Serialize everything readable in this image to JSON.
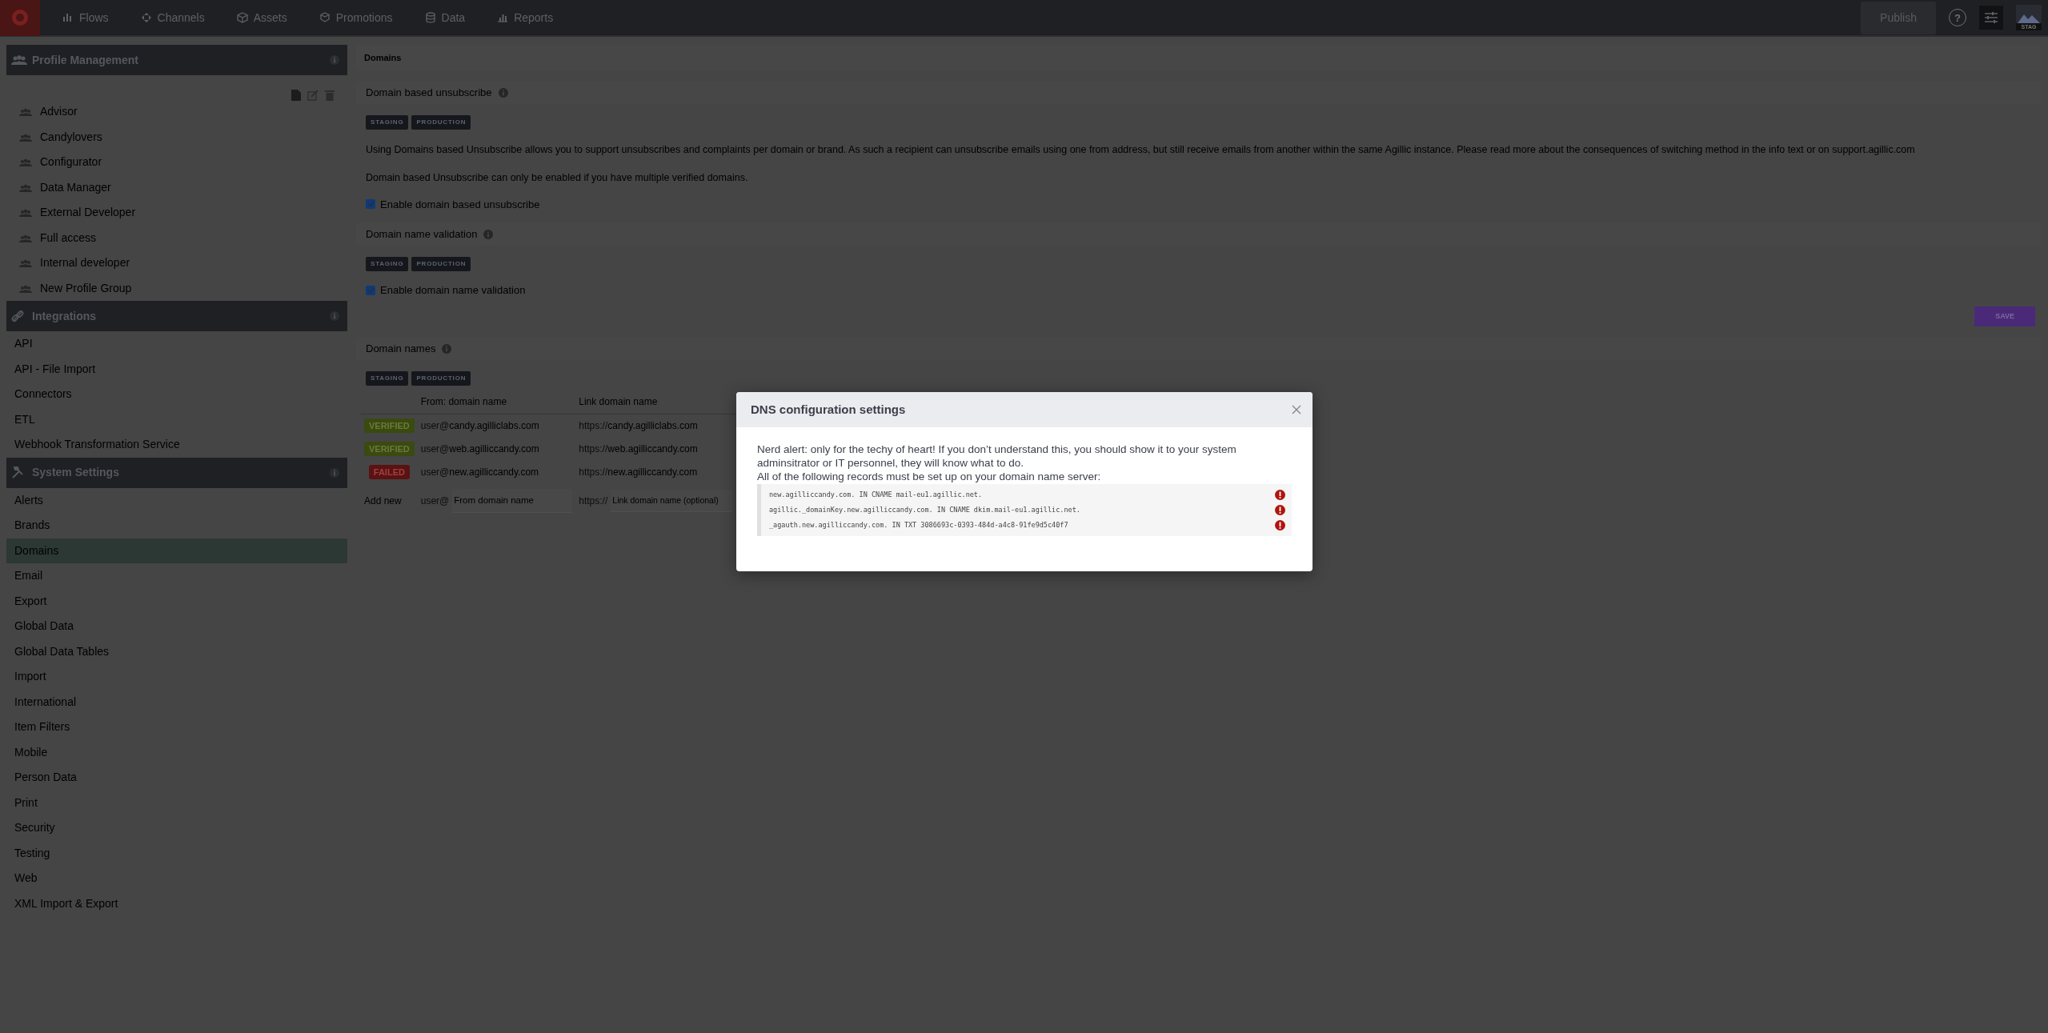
{
  "top_nav": {
    "items": [
      {
        "label": "Flows",
        "selected": false
      },
      {
        "label": "Channels",
        "selected": false
      },
      {
        "label": "Assets",
        "selected": false
      },
      {
        "label": "Promotions",
        "selected": false
      },
      {
        "label": "Data",
        "selected": false
      },
      {
        "label": "Reports",
        "selected": false
      }
    ],
    "publish": "Publish",
    "help": "?",
    "env_badge": "STAG"
  },
  "sidebar": {
    "sections": [
      {
        "title": "Profile Management",
        "kind": "profiles",
        "items": [
          {
            "label": "Advisor",
            "selected": false
          },
          {
            "label": "Candylovers",
            "selected": false
          },
          {
            "label": "Configurator",
            "selected": false
          },
          {
            "label": "Data Manager",
            "selected": false
          },
          {
            "label": "External Developer",
            "selected": false
          },
          {
            "label": "Full access",
            "selected": false
          },
          {
            "label": "Internal developer",
            "selected": false
          },
          {
            "label": "New Profile Group",
            "selected": false
          }
        ]
      },
      {
        "title": "Integrations",
        "kind": "integrations",
        "items": [
          {
            "label": "API",
            "selected": false
          },
          {
            "label": "API - File Import",
            "selected": false
          },
          {
            "label": "Connectors",
            "selected": false
          },
          {
            "label": "ETL",
            "selected": false
          },
          {
            "label": "Webhook Transformation Service",
            "selected": false
          }
        ]
      },
      {
        "title": "System Settings",
        "kind": "system",
        "items": [
          {
            "label": "Alerts",
            "selected": false
          },
          {
            "label": "Brands",
            "selected": false
          },
          {
            "label": "Domains",
            "selected": true
          },
          {
            "label": "Email",
            "selected": false
          },
          {
            "label": "Export",
            "selected": false
          },
          {
            "label": "Global Data",
            "selected": false
          },
          {
            "label": "Global Data Tables",
            "selected": false
          },
          {
            "label": "Import",
            "selected": false
          },
          {
            "label": "International",
            "selected": false
          },
          {
            "label": "Item Filters",
            "selected": false
          },
          {
            "label": "Mobile",
            "selected": false
          },
          {
            "label": "Person Data",
            "selected": false
          },
          {
            "label": "Print",
            "selected": false
          },
          {
            "label": "Security",
            "selected": false
          },
          {
            "label": "Testing",
            "selected": false
          },
          {
            "label": "Web",
            "selected": false
          },
          {
            "label": "XML Import & Export",
            "selected": false
          }
        ]
      }
    ]
  },
  "main": {
    "title": "Domains",
    "sections": [
      {
        "title": "Domain based unsubscribe",
        "envs": [
          "STAGING",
          "PRODUCTION"
        ],
        "paragraphs": [
          "Using Domains based Unsubscribe allows you to support unsubscribes and complaints per domain or brand. As such a recipient can unsubscribe emails using one from address, but still receive emails from another within the same Agillic instance. Please read more about the consequences of switching method in the info text or on support.agillic.com",
          "Domain based Unsubscribe can only be enabled if you have multiple verified domains."
        ],
        "checkbox": {
          "label": "Enable domain based unsubscribe",
          "checked": true
        }
      },
      {
        "title": "Domain name validation",
        "envs": [
          "STAGING",
          "PRODUCTION"
        ],
        "checkbox": {
          "label": "Enable domain name validation",
          "checked": true
        },
        "save": "SAVE"
      },
      {
        "title": "Domain names",
        "envs": [
          "STAGING",
          "PRODUCTION"
        ],
        "table": {
          "columns": [
            "From: domain name",
            "Link domain name"
          ],
          "rows": [
            {
              "status": "VERIFIED",
              "kind": "verified",
              "from_prefix": "user@",
              "from_domain": "candy.agilliclabs.com",
              "link_prefix": "https://",
              "link_domain": "candy.agilliclabs.com"
            },
            {
              "status": "VERIFIED",
              "kind": "verified",
              "from_prefix": "user@",
              "from_domain": "web.agilliccandy.com",
              "link_prefix": "https://",
              "link_domain": "web.agilliccandy.com"
            },
            {
              "status": "FAILED",
              "kind": "failed",
              "from_prefix": "user@",
              "from_domain": "new.agilliccandy.com",
              "link_prefix": "https://",
              "link_domain": "new.agilliccandy.com"
            }
          ],
          "add_new": {
            "label": "Add new",
            "from_prefix": "user@",
            "from_placeholder": "From domain name",
            "link_prefix": "https://",
            "link_placeholder": "Link domain name (optional)"
          }
        }
      }
    ]
  },
  "modal": {
    "title": "DNS configuration settings",
    "intro": "Nerd alert: only for the techy of heart! If you don’t understand this, you should show it to your system adminsitrator or IT personnel, they will know what to do.",
    "instruction": "All of the following records must be set up on your domain name server:",
    "records": [
      {
        "text": "new.agilliccandy.com. IN CNAME mail-eu1.agillic.net.",
        "valid": false
      },
      {
        "text": "agillic._domainKey.new.agilliccandy.com. IN CNAME dkim.mail-eu1.agillic.net.",
        "valid": false
      },
      {
        "text": "_agauth.new.agilliccandy.com. IN TXT 3086693c-0393-484d-a4c8-91fe9d5c40f7",
        "valid": false
      }
    ]
  }
}
